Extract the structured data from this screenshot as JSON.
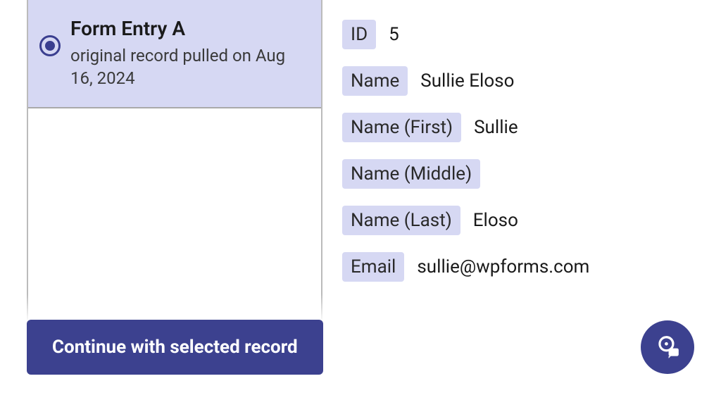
{
  "colors": {
    "accent": "#3c418f",
    "highlight": "#d6d8f3"
  },
  "sidebar": {
    "card": {
      "title": "Form Entry A",
      "subtitle": "original record pulled on Aug 16, 2024",
      "selected": true
    }
  },
  "details": {
    "fields": [
      {
        "label": "ID",
        "value": "5"
      },
      {
        "label": "Name",
        "value": "Sullie Eloso"
      },
      {
        "label": "Name (First)",
        "value": "Sullie"
      },
      {
        "label": "Name (Middle)",
        "value": ""
      },
      {
        "label": "Name (Last)",
        "value": "Eloso"
      },
      {
        "label": "Email",
        "value": "sullie@wpforms.com"
      }
    ]
  },
  "footer": {
    "continue_label": "Continue with selected record"
  }
}
